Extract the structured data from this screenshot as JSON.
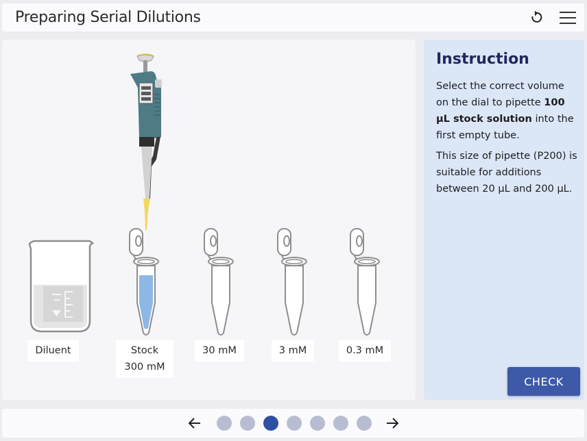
{
  "header": {
    "title": "Preparing Serial Dilutions",
    "reset_icon": "reset-icon",
    "menu_icon": "hamburger-menu-icon"
  },
  "stage": {
    "containers": [
      {
        "label": "Diluent",
        "sub": ""
      },
      {
        "label": "Stock",
        "sub": "300 mM"
      },
      {
        "label": "30 mM",
        "sub": ""
      },
      {
        "label": "3 mM",
        "sub": ""
      },
      {
        "label": "0.3 mM",
        "sub": ""
      }
    ]
  },
  "instruction": {
    "title": "Instruction",
    "p1_a": "Select the correct volume on the dial to pipette ",
    "p1_bold": "100 µL stock solution",
    "p1_b": " into the first empty tube.",
    "p2": "This size of pipette (P200) is suitable for additions between 20 µL and 200 µL.",
    "check_label": "CHECK"
  },
  "footer": {
    "prev_icon": "arrow-left-icon",
    "next_icon": "arrow-right-icon",
    "step_count": 7,
    "active_step": 3
  },
  "colors": {
    "accent": "#3d59a8",
    "active_dot": "#2f4fa3",
    "dot": "#b8bdd2",
    "panel_bg": "#dbe6f7",
    "stock_liquid": "#8db8e6",
    "pipette_body": "#4e7b86",
    "pipette_tip": "#f4d75c"
  }
}
